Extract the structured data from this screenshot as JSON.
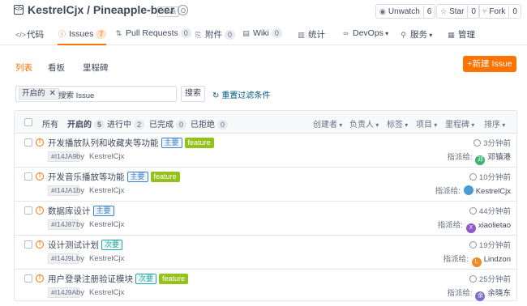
{
  "repo": {
    "owner": "KestrelCjx",
    "name": "Pineapple-beer",
    "title": "KestrelCjx / Pineapple-beer",
    "language": "Java",
    "unwatch_label": "Unwatch",
    "unwatch_count": "6",
    "star_label": "Star",
    "star_count": "0",
    "fork_label": "Fork",
    "fork_count": "0"
  },
  "tabs": [
    {
      "label": "代码",
      "icon": "code-icon"
    },
    {
      "label": "Issues",
      "count": "7",
      "icon": "issue-icon"
    },
    {
      "label": "Pull Requests",
      "count": "0",
      "icon": "pull-request-icon"
    },
    {
      "label": "附件",
      "count": "0",
      "icon": "paperclip-icon"
    },
    {
      "label": "Wiki",
      "count": "0",
      "icon": "book-icon"
    },
    {
      "label": "统计",
      "icon": "chart-icon"
    },
    {
      "label": "DevOps",
      "icon": "devops-icon"
    },
    {
      "label": "服务",
      "icon": "service-icon"
    },
    {
      "label": "管理",
      "icon": "settings-icon"
    }
  ],
  "subtabs": {
    "list": "列表",
    "board": "看板",
    "milestone": "里程碑"
  },
  "new_issue_label": "+新建 Issue",
  "filter": {
    "chip_label": "开启的",
    "search_placeholder": "搜索 Issue",
    "search_button": "搜索",
    "reset_label": "重置过滤条件"
  },
  "list_header": {
    "all": "所有",
    "open": "开启的",
    "open_count": "5",
    "progressing": "进行中",
    "progressing_count": "2",
    "closed": "已完成",
    "closed_count": "0",
    "rejected": "已拒绝",
    "rejected_count": "0",
    "filters": [
      "创建者",
      "负责人",
      "标签",
      "项目",
      "里程碑",
      "排序"
    ]
  },
  "issues": [
    {
      "title": "开发播放队列和收藏夹等功能",
      "labels": [
        {
          "text": "主要",
          "style": "blue"
        },
        {
          "text": "feature",
          "style": "green"
        }
      ],
      "id": "#I14JA9",
      "by": "by",
      "author": "KestrelCjx",
      "time": "3分钟前",
      "assign_label": "指派给:",
      "assignee": "邓镇港",
      "avatar_color": "#3bb273",
      "avatar_char": "邓"
    },
    {
      "title": "开发音乐播放等功能",
      "labels": [
        {
          "text": "主要",
          "style": "blue"
        },
        {
          "text": "feature",
          "style": "green"
        }
      ],
      "id": "#I14JA1",
      "by": "by",
      "author": "KestrelCjx",
      "time": "10分钟前",
      "assign_label": "指派给:",
      "assignee": "KestrelCjx",
      "avatar_color": "#4a9bd4",
      "avatar_char": ""
    },
    {
      "title": "数据库设计",
      "labels": [
        {
          "text": "主要",
          "style": "blue"
        }
      ],
      "id": "#I14J87",
      "by": "by",
      "author": "KestrelCjx",
      "time": "44分钟前",
      "assign_label": "指派给:",
      "assignee": "xiaolietao",
      "avatar_color": "#8e59c9",
      "avatar_char": "X"
    },
    {
      "title": "设计测试计划",
      "labels": [
        {
          "text": "次要",
          "style": "teal"
        }
      ],
      "id": "#I14J9L",
      "by": "by",
      "author": "KestrelCjx",
      "time": "19分钟前",
      "assign_label": "指派给:",
      "assignee": "Lindzon",
      "avatar_color": "#f08a24",
      "avatar_char": "L"
    },
    {
      "title": "用户登录注册验证模块",
      "labels": [
        {
          "text": "次要",
          "style": "teal"
        },
        {
          "text": "feature",
          "style": "green"
        }
      ],
      "id": "#I14J9A",
      "by": "by",
      "author": "KestrelCjx",
      "time": "25分钟前",
      "assign_label": "指派给:",
      "assignee": "余晓东",
      "avatar_color": "#7b6cc9",
      "avatar_char": "余"
    }
  ]
}
